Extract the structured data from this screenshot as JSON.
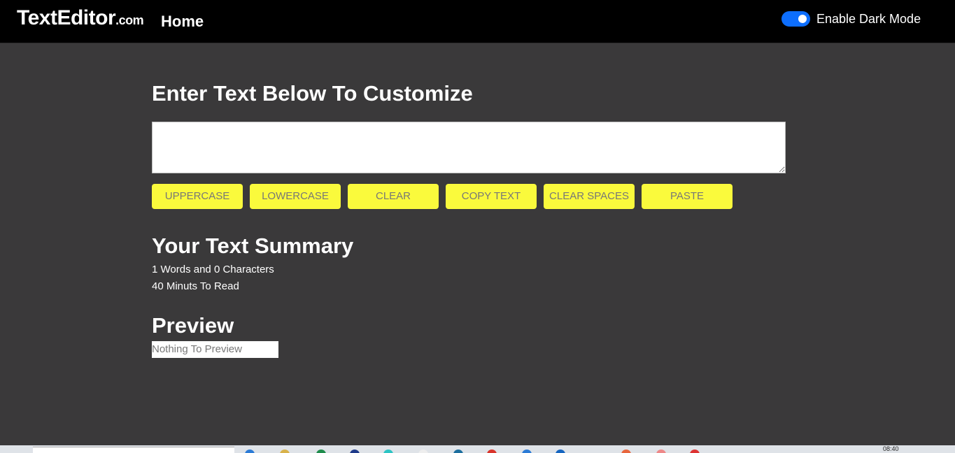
{
  "navbar": {
    "brand_main": "TextEditor",
    "brand_tld": ".com",
    "home_label": "Home",
    "dark_mode_label": "Enable Dark Mode",
    "dark_mode_enabled": true
  },
  "editor": {
    "heading": "Enter Text Below To Customize",
    "text_value": "",
    "buttons": [
      "UPPERCASE",
      "LOWERCASE",
      "CLEAR",
      "COPY TEXT",
      "CLEAR SPACES",
      "PASTE"
    ]
  },
  "summary": {
    "title": "Your Text Summary",
    "counts_line": "1 Words and 0 Characters",
    "read_time_line": "40 Minuts To Read"
  },
  "preview": {
    "title": "Preview",
    "text": "Nothing To Preview"
  },
  "taskbar": {
    "time": "08:40"
  },
  "colors": {
    "page_bg": "#3a393a",
    "navbar_bg": "#000000",
    "button_bg": "#fafa3c",
    "toggle_on": "#0d6efd"
  }
}
